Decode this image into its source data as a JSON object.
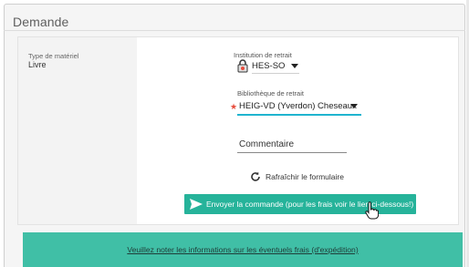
{
  "section": {
    "title": "Demande"
  },
  "type_materiel": {
    "label": "Type de matériel",
    "value": "Livre"
  },
  "institution": {
    "label": "Institution de retrait",
    "selected": "HES-SO"
  },
  "bibliotheque": {
    "label": "Bibliothèque de retrait",
    "selected": "HEIG-VD (Yverdon) Cheseaux",
    "required_marker": "★"
  },
  "commentaire": {
    "placeholder": "Commentaire"
  },
  "refresh": {
    "label": "Rafraîchir le formulaire"
  },
  "send": {
    "label": "Envoyer la commande (pour les frais voir le lien ci-dessous!)"
  },
  "notice": {
    "link_text": "Veuillez noter les informations sur les éventuels frais (d'expédition)"
  },
  "colors": {
    "accent": "#26b39a",
    "focus_underline": "#1fb4cf",
    "notice_bg": "#40bfa6",
    "required": "#e74c3c"
  },
  "icons": {
    "lock": "lock-icon",
    "refresh": "refresh-icon",
    "send": "send-icon",
    "cursor": "hand-cursor-icon"
  }
}
